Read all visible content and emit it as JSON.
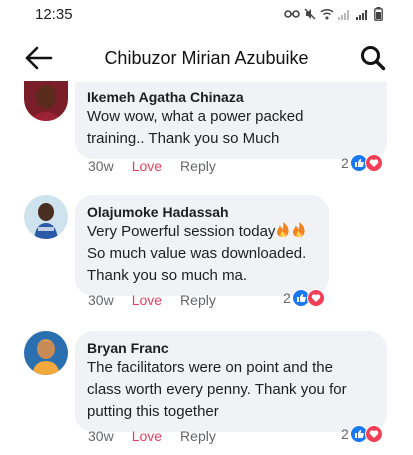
{
  "status": {
    "time": "12:35"
  },
  "header": {
    "title": "Chibuzor Mirian Azubuike"
  },
  "comments": [
    {
      "author": "Ikemeh Agatha Chinaza",
      "lines": [
        "Wow wow,  what a power packed",
        "training.. Thank you so Much"
      ],
      "age": "30w",
      "love": "Love",
      "reply": "Reply",
      "reaction_count": "2"
    },
    {
      "author": "Olajumoke Hadassah",
      "lines": [
        "Very Powerful session today",
        "So much value was downloaded.",
        "Thank you so much ma."
      ],
      "age": "30w",
      "love": "Love",
      "reply": "Reply",
      "reaction_count": "2"
    },
    {
      "author": "Bryan Franc",
      "lines": [
        "The facilitators were on point and the",
        "class worth every penny. Thank you for",
        "putting this together"
      ],
      "age": "30w",
      "love": "Love",
      "reply": "Reply",
      "reaction_count": "2"
    }
  ],
  "icons": {
    "back": "arrow-left-icon",
    "search": "search-icon",
    "like": "like-reaction-icon",
    "heart": "heart-reaction-icon",
    "fire": "fire-emoji-icon"
  },
  "colors": {
    "love": "#e4405f",
    "like": "#1877f2",
    "heart": "#f33e58",
    "bubble": "#f0f2f5"
  }
}
